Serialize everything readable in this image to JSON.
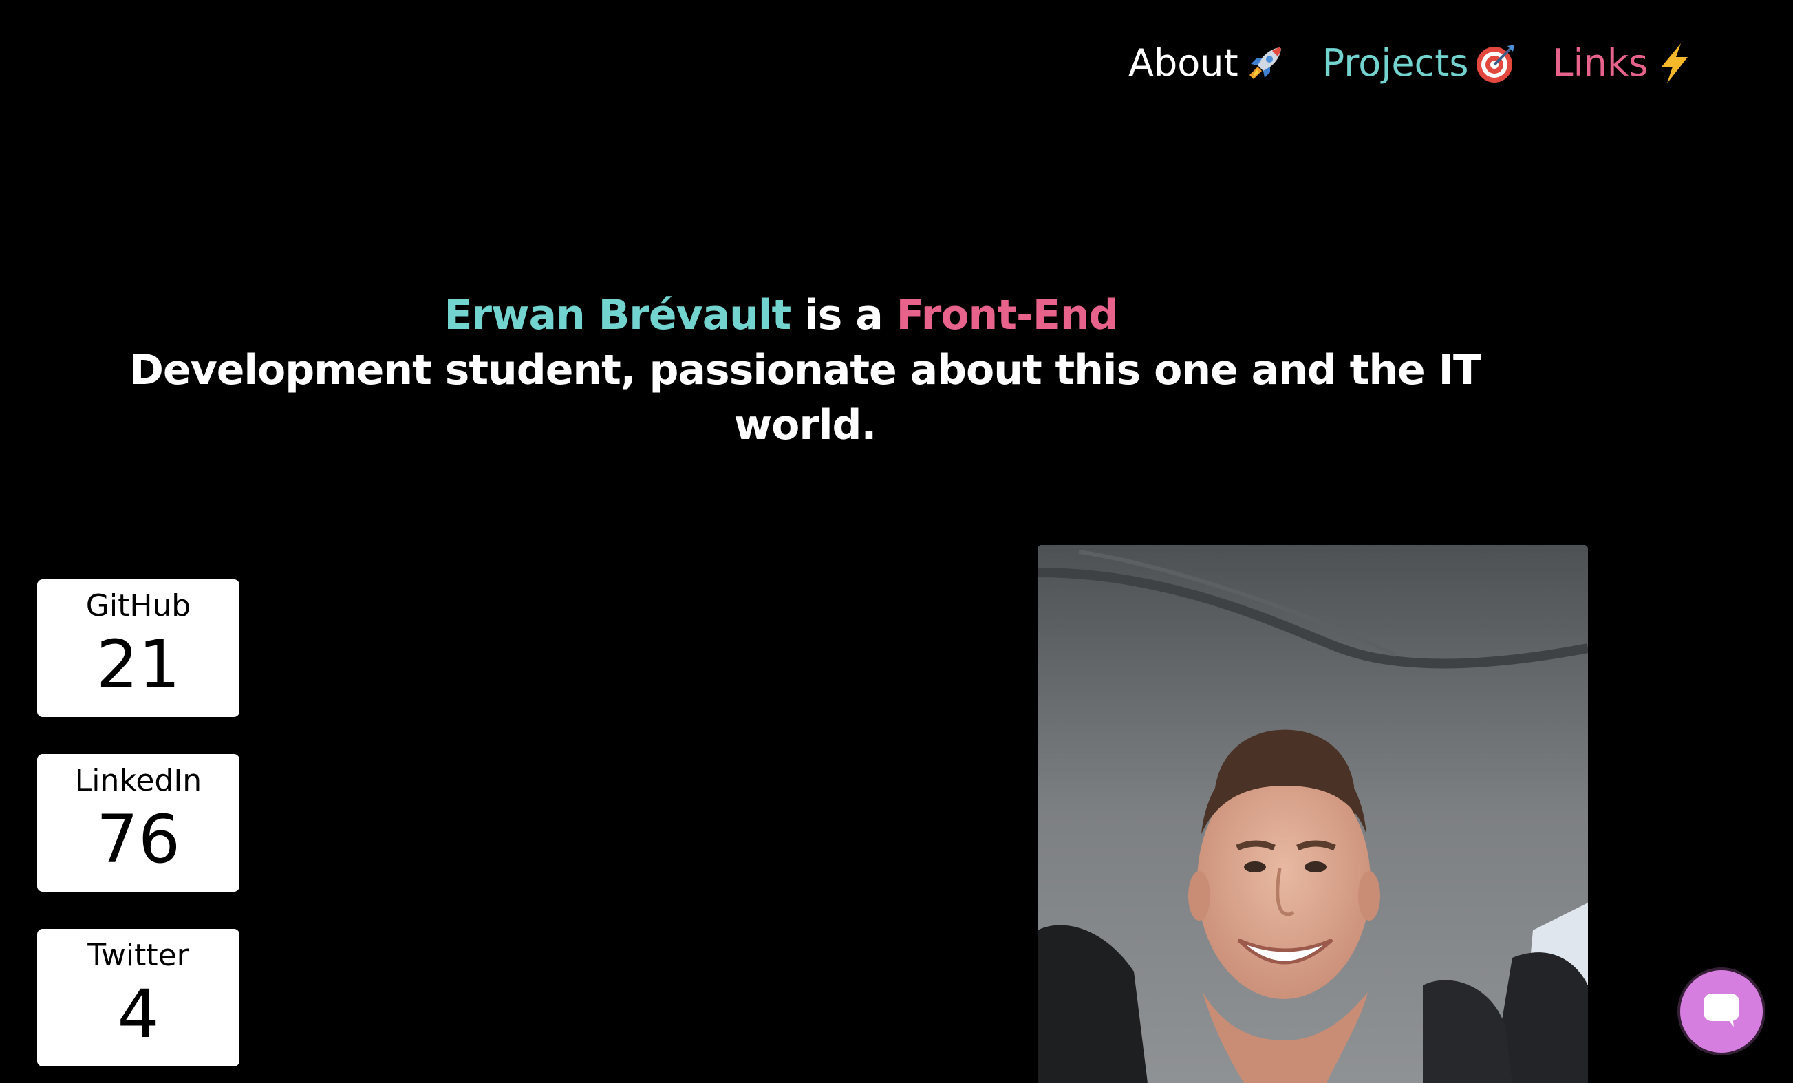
{
  "nav": {
    "items": [
      {
        "label": "About",
        "icon": "rocket-icon",
        "color": "#ffffff"
      },
      {
        "label": "Projects",
        "icon": "target-icon",
        "color": "#72d3cf"
      },
      {
        "label": "Links",
        "icon": "lightning-icon",
        "color": "#e8638b"
      }
    ]
  },
  "hero": {
    "name": "Erwan Brévault",
    "connector": " is a ",
    "role": "Front-End",
    "rest": "Development student, passionate about this one and the IT world.",
    "name_color": "#72d3cf",
    "role_color": "#e8638b"
  },
  "stats": [
    {
      "label": "GitHub",
      "count": "21"
    },
    {
      "label": "LinkedIn",
      "count": "76"
    },
    {
      "label": "Twitter",
      "count": "4"
    }
  ],
  "chat": {
    "icon": "chat-bubble-icon",
    "color": "#d67ee0"
  },
  "photo": {
    "subject": "portrait-photo"
  }
}
